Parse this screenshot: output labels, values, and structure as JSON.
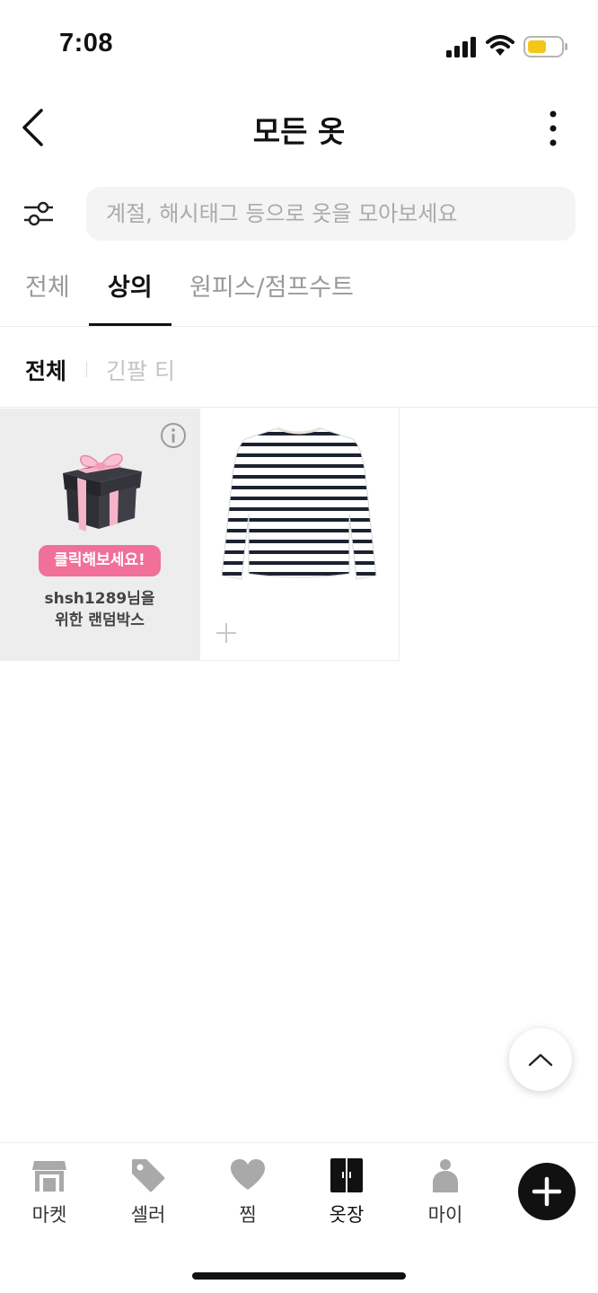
{
  "status_bar": {
    "time": "7:08"
  },
  "header": {
    "title": "모든 옷"
  },
  "search": {
    "placeholder": "계절, 해시태그 등으로 옷을 모아보세요"
  },
  "category_tabs": [
    {
      "label": "전체",
      "active": false
    },
    {
      "label": "상의",
      "active": true
    },
    {
      "label": "원피스/점프수트",
      "active": false
    }
  ],
  "subcategories": [
    {
      "label": "전체",
      "active": true
    },
    {
      "label": "긴팔 티",
      "active": false
    }
  ],
  "promo_card": {
    "badge": "클릭해보세요!",
    "line1": "shsh1289님을",
    "line2": "위한 랜덤박스",
    "colors": {
      "badge": "#f0709a",
      "box": "#2f2f36",
      "ribbon": "#f6b4c8"
    }
  },
  "products": [
    {
      "image": "striped-long-sleeve-shirt",
      "pattern_colors": [
        "#1c2230",
        "#ffffff"
      ]
    }
  ],
  "bottom_nav": {
    "items": [
      {
        "label": "마켓",
        "icon": "store-icon",
        "active": false
      },
      {
        "label": "셀러",
        "icon": "tag-icon",
        "active": false
      },
      {
        "label": "찜",
        "icon": "heart-icon",
        "active": false
      },
      {
        "label": "옷장",
        "icon": "wardrobe-icon",
        "active": true
      },
      {
        "label": "마이",
        "icon": "person-icon",
        "active": false
      }
    ],
    "fab_icon": "plus-icon"
  }
}
